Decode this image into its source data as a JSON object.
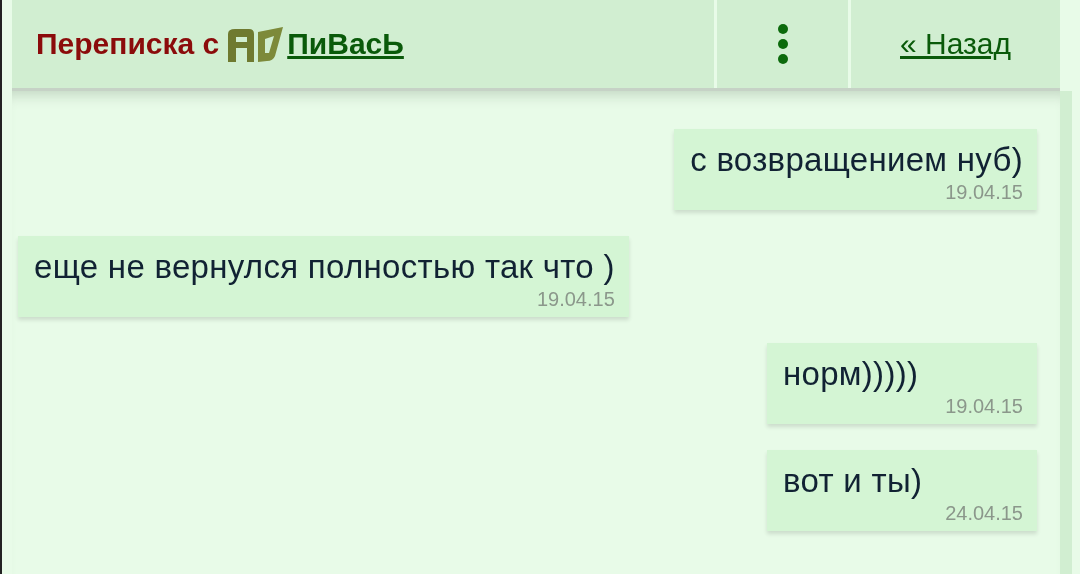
{
  "header": {
    "title_prefix": "Переписка с",
    "contact": "ПиВасЬ",
    "back": "« Назад"
  },
  "messages": [
    {
      "kind": "outgoing",
      "text": "с возвращением нуб)",
      "date": "19.04.15"
    },
    {
      "kind": "incoming",
      "text": "еще не вернулся полностью так что )",
      "date": "19.04.15"
    },
    {
      "kind": "outgoing",
      "text": "норм)))))",
      "date": "19.04.15"
    },
    {
      "kind": "outgoing",
      "text": "вот и ты)",
      "date": "24.04.15"
    }
  ]
}
